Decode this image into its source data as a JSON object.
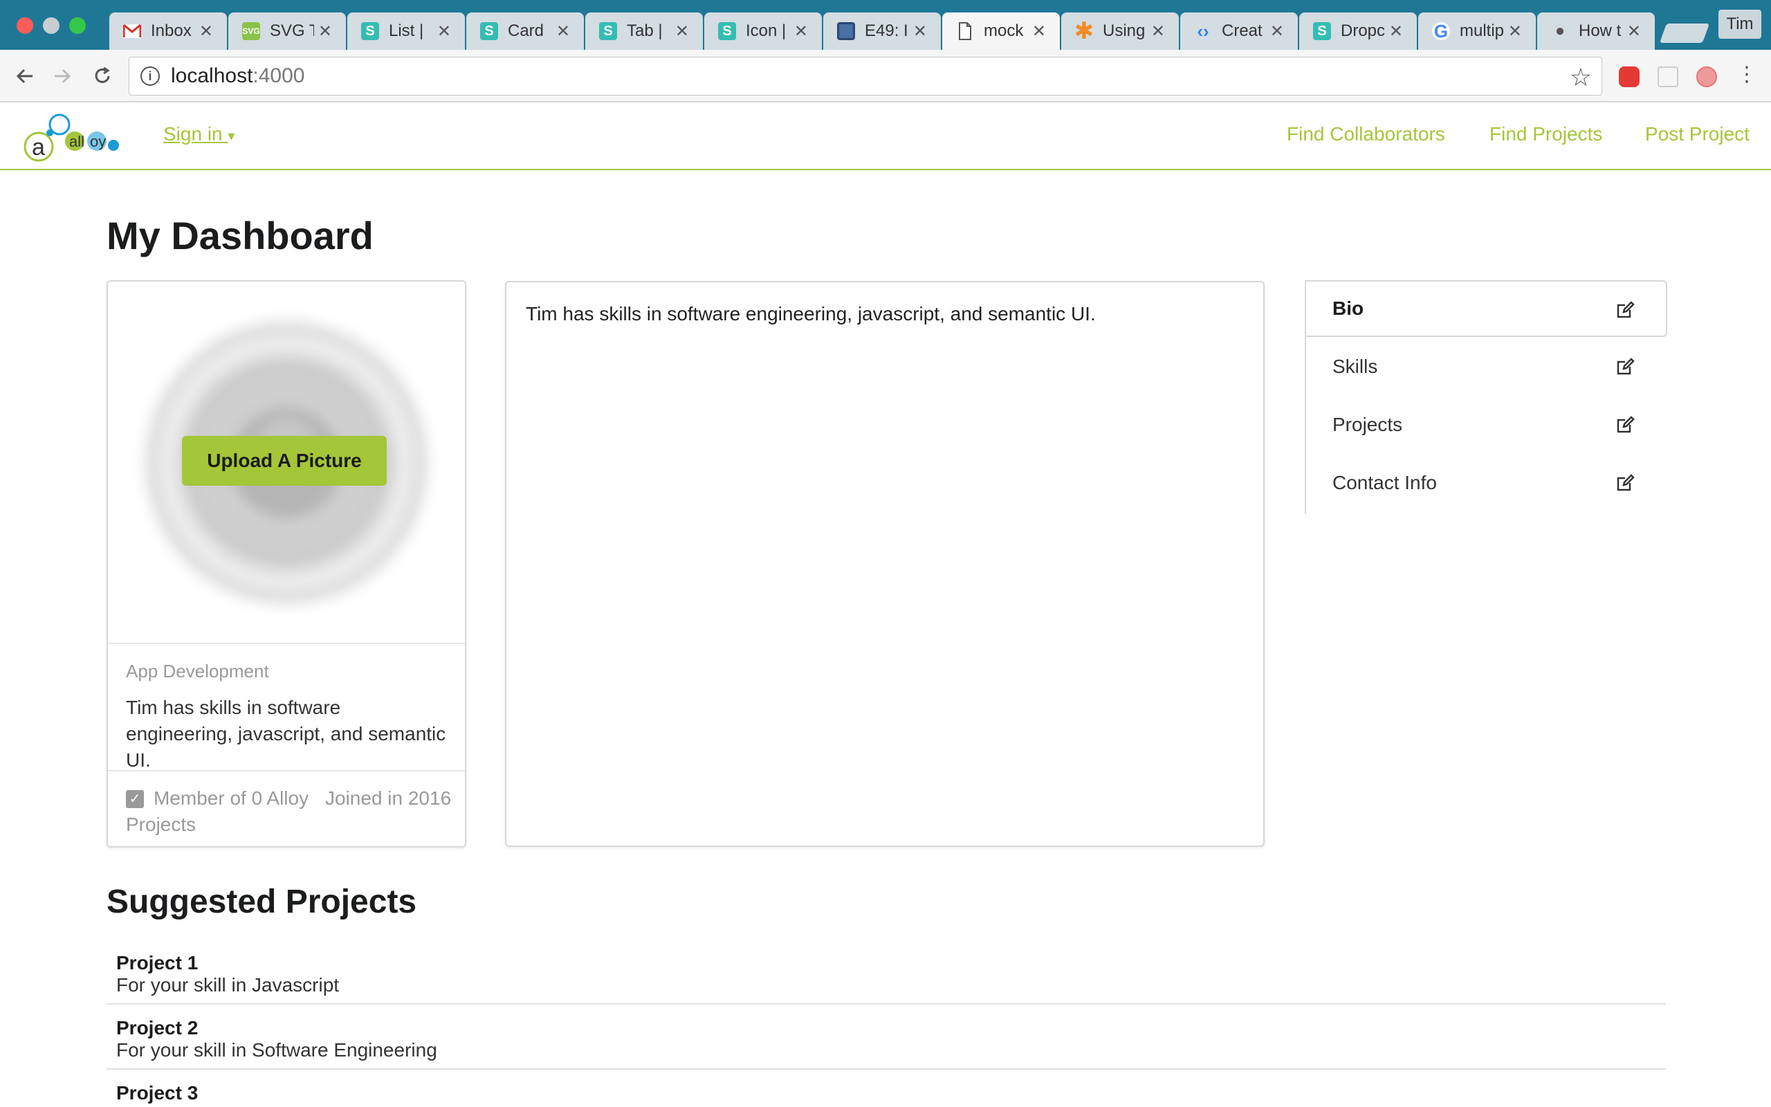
{
  "browser": {
    "tabs": [
      {
        "title": "Inbox",
        "icon": "gmail-icon",
        "color": "#ffffff"
      },
      {
        "title": "SVG T",
        "icon": "svg-icon",
        "color": "#8bc34a"
      },
      {
        "title": "List |",
        "icon": "semantic-s-icon",
        "color": "#35bdb2"
      },
      {
        "title": "Card",
        "icon": "semantic-s-icon",
        "color": "#35bdb2"
      },
      {
        "title": "Tab |",
        "icon": "semantic-s-icon",
        "color": "#35bdb2"
      },
      {
        "title": "Icon |",
        "icon": "semantic-s-icon",
        "color": "#35bdb2"
      },
      {
        "title": "E49: I",
        "icon": "square-icon",
        "color": "#4a6fa5"
      },
      {
        "title": "mock",
        "icon": "document-icon",
        "color": "#ffffff"
      },
      {
        "title": "Using",
        "icon": "asterisk-icon",
        "color": "#f28b24"
      },
      {
        "title": "Creat",
        "icon": "code-icon",
        "color": "#2f80ed"
      },
      {
        "title": "Dropc",
        "icon": "semantic-s-icon",
        "color": "#35bdb2"
      },
      {
        "title": "multip",
        "icon": "google-icon",
        "color": "#ffffff"
      },
      {
        "title": "How t",
        "icon": "apple-icon",
        "color": "#ffffff"
      }
    ],
    "profile_name": "Tim",
    "url_host": "localhost",
    "url_port": ":4000"
  },
  "nav": {
    "signin_label": "Sign in",
    "links": [
      "Find Collaborators",
      "Find Projects",
      "Post Project"
    ]
  },
  "page": {
    "title": "My Dashboard"
  },
  "profile_card": {
    "upload_label": "Upload A Picture",
    "category": "App Development",
    "description": "Tim has skills in software engineering, javascript, and semantic UI.",
    "member_line": "Member of 0 Alloy Projects",
    "joined": "Joined in 2016"
  },
  "bio_panel": {
    "text": "Tim has skills in software engineering, javascript, and semantic UI."
  },
  "side_menu": {
    "items": [
      "Bio",
      "Skills",
      "Projects",
      "Contact Info"
    ],
    "active": "Bio"
  },
  "suggested": {
    "title": "Suggested Projects",
    "projects": [
      {
        "name": "Project 1",
        "reason": "For your skill in Javascript"
      },
      {
        "name": "Project 2",
        "reason": "For your skill in Software Engineering"
      },
      {
        "name": "Project 3",
        "reason": ""
      }
    ]
  },
  "colors": {
    "accent": "#a4c639",
    "chrome": "#1f7796"
  }
}
